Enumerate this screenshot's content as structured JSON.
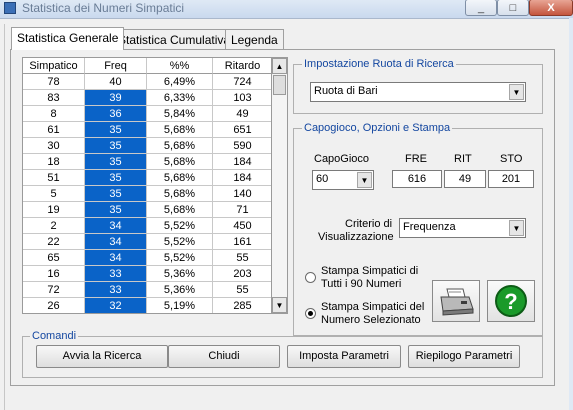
{
  "window": {
    "title": "Statistica dei Numeri Simpatici",
    "minimize": "_",
    "maximize": "□",
    "close": "X"
  },
  "tabs": [
    "Statistica Generale",
    "Statistica Cumulativa",
    "Legenda"
  ],
  "table": {
    "headers": [
      "Simpatico",
      "Freq",
      "%%",
      "Ritardo"
    ],
    "rows": [
      [
        "78",
        "40",
        "6,49%",
        "724"
      ],
      [
        "83",
        "39",
        "6,33%",
        "103"
      ],
      [
        "8",
        "36",
        "5,84%",
        "49"
      ],
      [
        "61",
        "35",
        "5,68%",
        "651"
      ],
      [
        "30",
        "35",
        "5,68%",
        "590"
      ],
      [
        "18",
        "35",
        "5,68%",
        "184"
      ],
      [
        "51",
        "35",
        "5,68%",
        "184"
      ],
      [
        "5",
        "35",
        "5,68%",
        "140"
      ],
      [
        "19",
        "35",
        "5,68%",
        "71"
      ],
      [
        "2",
        "34",
        "5,52%",
        "450"
      ],
      [
        "22",
        "34",
        "5,52%",
        "161"
      ],
      [
        "65",
        "34",
        "5,52%",
        "55"
      ],
      [
        "16",
        "33",
        "5,36%",
        "203"
      ],
      [
        "72",
        "33",
        "5,36%",
        "55"
      ],
      [
        "26",
        "32",
        "5,19%",
        "285"
      ]
    ],
    "scroll_up": "▲",
    "scroll_down": "▼",
    "highlight_color": "#0a63c8"
  },
  "ruota": {
    "label": "Impostazione Ruota di Ricerca",
    "value": "Ruota di Bari"
  },
  "opzioni": {
    "label": "Capogioco, Opzioni e Stampa",
    "capogioco_label": "CapoGioco",
    "capogioco_value": "60",
    "fre_label": "FRE",
    "rit_label": "RIT",
    "sto_label": "STO",
    "fre_value": "616",
    "rit_value": "49",
    "sto_value": "201",
    "criterio_label_1": "Criterio di",
    "criterio_label_2": "Visualizzazione",
    "criterio_value": "Frequenza",
    "radio1_line1": "Stampa Simpatici di",
    "radio1_line2": "Tutti i 90 Numeri",
    "radio2_line1": "Stampa Simpatici del",
    "radio2_line2": "Numero Selezionato",
    "help_glyph": "?",
    "dropdown_arrow": "▼"
  },
  "comandi": {
    "label": "Comandi",
    "buttons": [
      "Avvia la Ricerca",
      "Chiudi",
      "Imposta Parametri",
      "Riepilogo Parametri"
    ]
  }
}
